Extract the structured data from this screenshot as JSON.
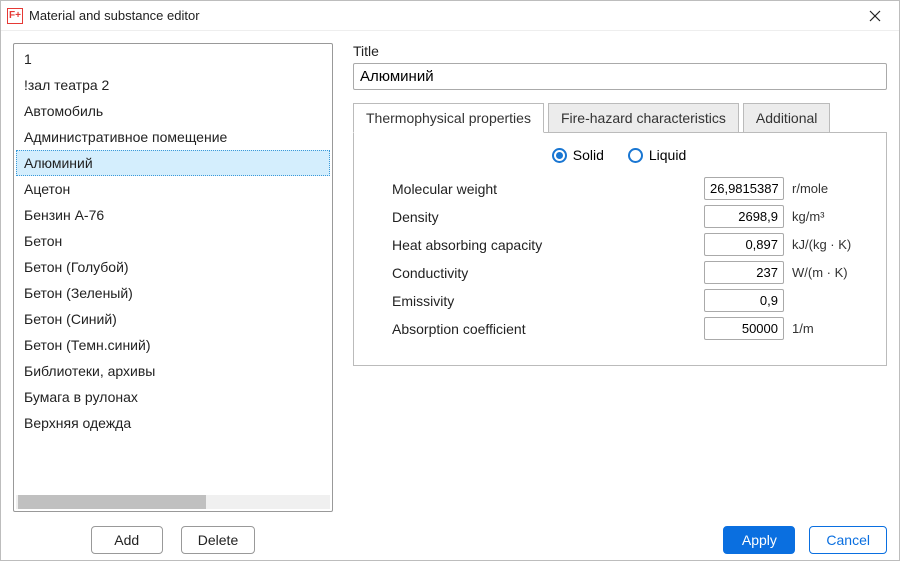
{
  "app_icon_text": "F+",
  "window_title": "Material and substance editor",
  "list_items": [
    "1",
    "!зал театра 2",
    "Автомобиль",
    "Административное помещение",
    "Алюминий",
    "Ацетон",
    "Бензин А-76",
    "Бетон",
    "Бетон (Голубой)",
    "Бетон (Зеленый)",
    "Бетон (Синий)",
    "Бетон (Темн.синий)",
    "Библиотеки, архивы",
    "Бумага в рулонах",
    "Верхняя одежда"
  ],
  "selected_index": 4,
  "left": {
    "add": "Add",
    "delete": "Delete"
  },
  "title_label": "Title",
  "title_value": "Алюминий",
  "tabs": {
    "thermo": "Thermophysical properties",
    "fire": "Fire-hazard characteristics",
    "additional": "Additional"
  },
  "phase": {
    "solid": "Solid",
    "liquid": "Liquid",
    "selected": "solid"
  },
  "props": {
    "mw": {
      "label": "Molecular weight",
      "value": "26,9815387",
      "unit": "r/mole"
    },
    "density": {
      "label": "Density",
      "value": "2698,9",
      "unit": "kg/m³"
    },
    "heat": {
      "label": "Heat absorbing capacity",
      "value": "0,897",
      "unit": "kJ/(kg · K)"
    },
    "cond": {
      "label": "Conductivity",
      "value": "237",
      "unit": "W/(m · K)"
    },
    "emis": {
      "label": "Emissivity",
      "value": "0,9",
      "unit": ""
    },
    "abs": {
      "label": "Absorption coefficient",
      "value": "50000",
      "unit": "1/m"
    }
  },
  "footer": {
    "apply": "Apply",
    "cancel": "Cancel"
  }
}
